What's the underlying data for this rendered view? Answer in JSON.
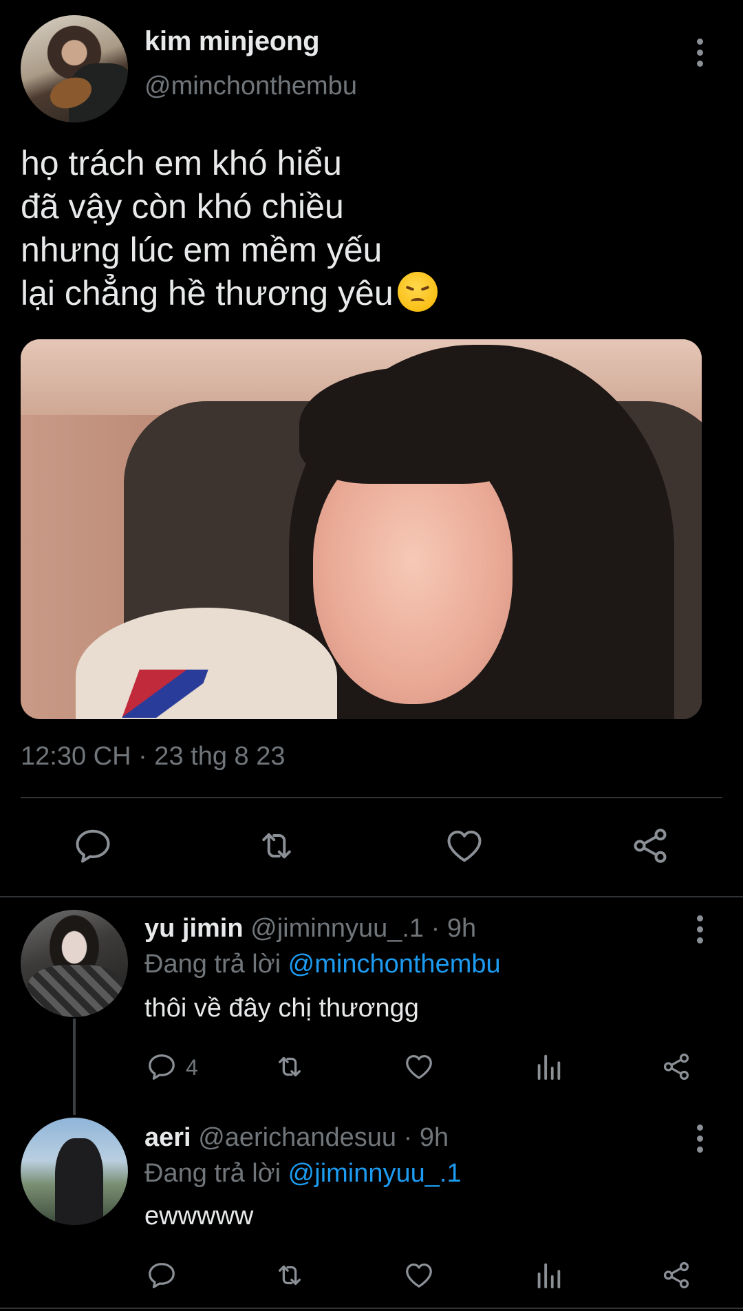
{
  "main_tweet": {
    "display_name": "kim minjeong",
    "handle": "@minchonthembu",
    "text_lines": [
      "họ trách em khó hiểu",
      "đã vậy còn khó chiều",
      "nhưng lúc em mềm yếu",
      "lại chẳng hề thương yêu"
    ],
    "emoji": "disappointed-face-emoji",
    "timestamp": "12:30 CH · 23 thg 8 23",
    "actions": [
      "reply-icon",
      "retweet-icon",
      "like-icon",
      "share-icon"
    ]
  },
  "replies": [
    {
      "display_name": "yu jimin",
      "meta": "@jiminnyuu_.1 · 9h",
      "replying_prefix": "Đang trả lời",
      "replying_to": "@minchonthembu",
      "text": "thôi về đây chị thươngg",
      "reply_count": "4"
    },
    {
      "display_name": "aeri",
      "meta": "@aerichandesuu · 9h",
      "replying_prefix": "Đang trả lời",
      "replying_to": "@jiminnyuu_.1",
      "text": "ewwwww",
      "reply_count": ""
    }
  ],
  "colors": {
    "background": "#000000",
    "text": "#e7e9ea",
    "secondary": "#71767b",
    "mention": "#1d9bf0",
    "divider": "#2f3336"
  }
}
